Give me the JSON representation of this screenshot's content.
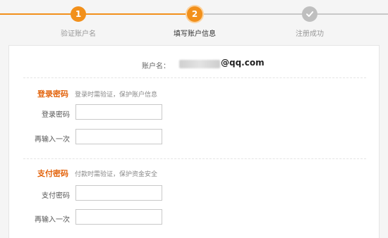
{
  "steps": [
    {
      "number": "1",
      "label": "验证账户名",
      "state": "done"
    },
    {
      "number": "2",
      "label": "填写账户信息",
      "state": "current"
    },
    {
      "number": "",
      "label": "注册成功",
      "state": "pending"
    }
  ],
  "colors": {
    "accent": "#f2901b",
    "section_title": "#e3640d",
    "pending": "#bfbfbf"
  },
  "account": {
    "label": "账户名：",
    "domain": "@qq.com"
  },
  "login_section": {
    "title": "登录密码",
    "hint": "登录时需验证，保护账户信息",
    "password_label": "登录密码",
    "password_value": "",
    "confirm_label": "再输入一次",
    "confirm_value": ""
  },
  "pay_section": {
    "title": "支付密码",
    "hint": "付款时需验证，保护资金安全",
    "password_label": "支付密码",
    "password_value": "",
    "confirm_label": "再输入一次",
    "confirm_value": ""
  }
}
